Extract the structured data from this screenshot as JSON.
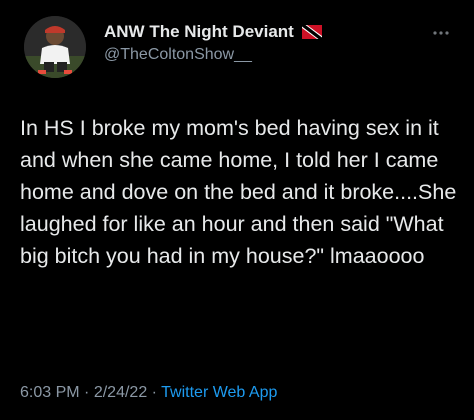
{
  "tweet": {
    "author": {
      "display_name": "ANW The Night Deviant",
      "handle": "@TheColtonShow__",
      "flag_icon": "trinidad-and-tobago-flag-icon"
    },
    "text": "In HS I broke my mom's bed having sex in it and when she came home, I told her I came home and dove on the bed and it broke....She laughed for like an hour and then said \"What big bitch you had in my house?\" lmaaoooo",
    "time": "6:03 PM",
    "date": "2/24/22",
    "source": "Twitter Web App",
    "separator": "·",
    "more_icon": "more-horizontal-icon"
  },
  "colors": {
    "background": "#000000",
    "primary_text": "#e7e9ea",
    "secondary_text": "#8b98a5",
    "link": "#1d9bf0"
  }
}
